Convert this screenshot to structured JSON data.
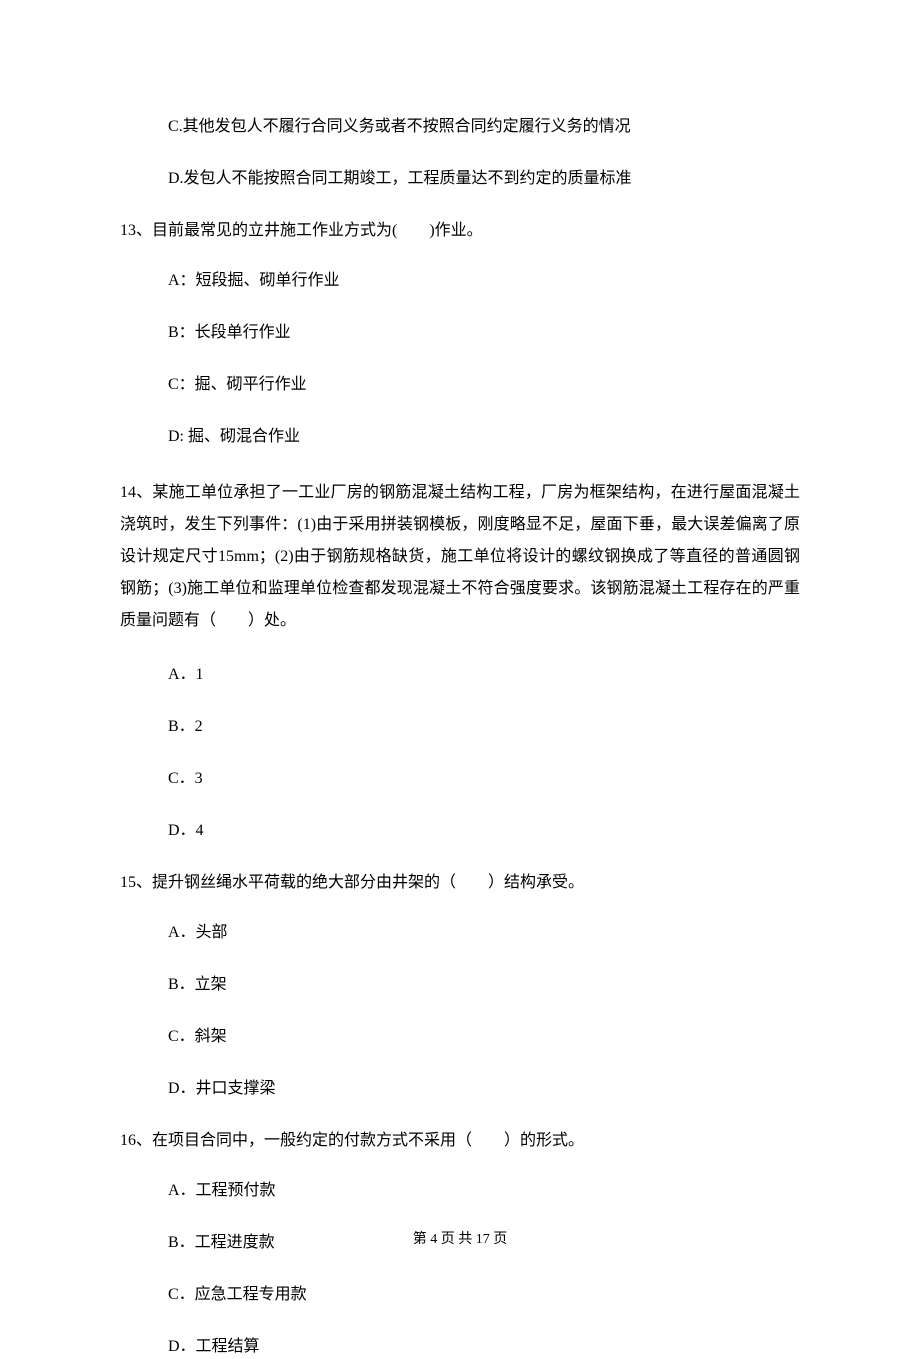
{
  "continuedOptions": [
    "C.其他发包人不履行合同义务或者不按照合同约定履行义务的情况",
    "D.发包人不能按照合同工期竣工，工程质量达不到约定的质量标准"
  ],
  "questions": [
    {
      "number": "13、",
      "text": "目前最常见的立井施工作业方式为(　　)作业。",
      "options": [
        "A：短段掘、砌单行作业",
        "B：长段单行作业",
        "C：掘、砌平行作业",
        "D: 掘、砌混合作业"
      ]
    },
    {
      "number": "14、",
      "text": "某施工单位承担了一工业厂房的钢筋混凝土结构工程，厂房为框架结构，在进行屋面混凝土浇筑时，发生下列事件：(1)由于采用拼装钢模板，刚度略显不足，屋面下垂，最大误差偏离了原设计规定尺寸15mm；(2)由于钢筋规格缺货，施工单位将设计的螺纹钢换成了等直径的普通圆钢钢筋；(3)施工单位和监理单位检查都发现混凝土不符合强度要求。该钢筋混凝土工程存在的严重质量问题有（　　）处。",
      "options": [
        "A．1",
        "B．2",
        "C．3",
        "D．4"
      ]
    },
    {
      "number": "15、",
      "text": "提升钢丝绳水平荷载的绝大部分由井架的（　　）结构承受。",
      "options": [
        "A．头部",
        "B．立架",
        "C．斜架",
        "D．井口支撑梁"
      ]
    },
    {
      "number": "16、",
      "text": "在项目合同中，一般约定的付款方式不采用（　　）的形式。",
      "options": [
        "A．工程预付款",
        "B．工程进度款",
        "C．应急工程专用款",
        "D．工程结算"
      ]
    }
  ],
  "footer": "第 4 页 共 17 页"
}
